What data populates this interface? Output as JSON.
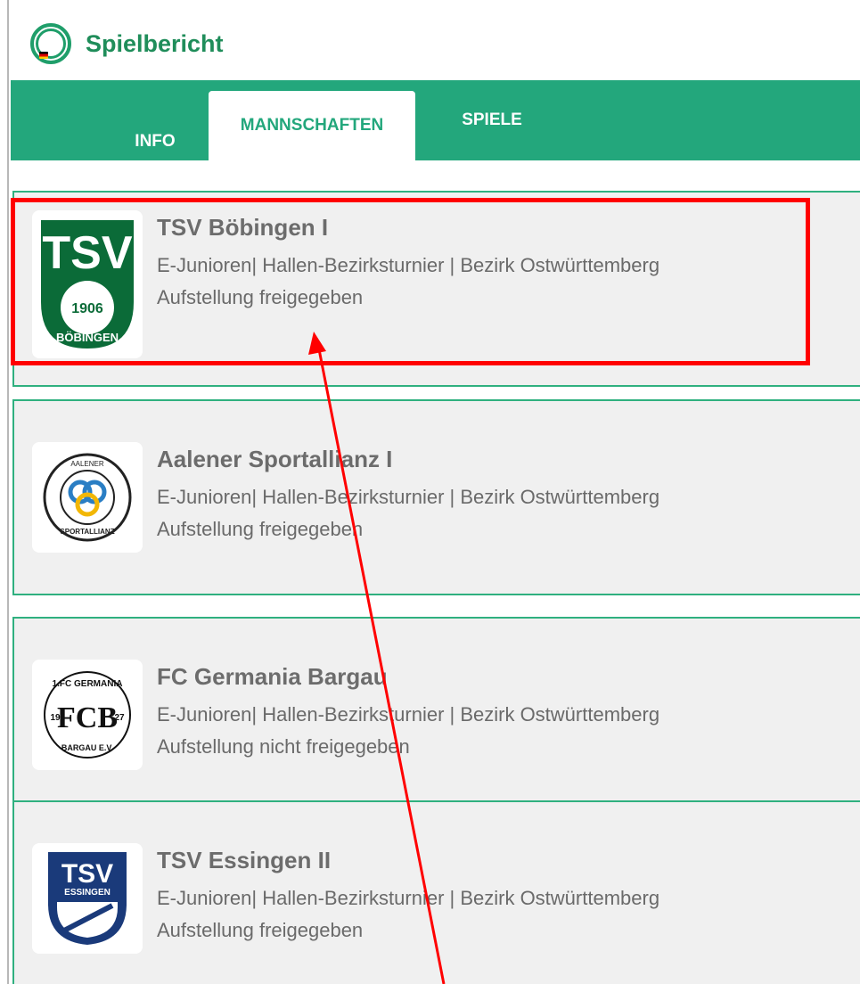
{
  "header": {
    "title": "Spielbericht",
    "logo_icon": "dfb-logo-icon"
  },
  "tabs": [
    {
      "label": "INFO",
      "active": false
    },
    {
      "label": "MANNSCHAFTEN",
      "active": true
    },
    {
      "label": "SPIELE",
      "active": false
    }
  ],
  "teams": [
    {
      "name": "TSV Böbingen I",
      "meta": "E-Junioren| Hallen-Bezirksturnier | Bezirk Ostwürttemberg",
      "status": "Aufstellung freigegeben",
      "crest": {
        "big": "TSV",
        "year": "1906",
        "arc": "BÖBINGEN"
      }
    },
    {
      "name": "Aalener Sportallianz I",
      "meta": "E-Junioren| Hallen-Bezirksturnier | Bezirk Ostwürttemberg",
      "status": "Aufstellung freigegeben",
      "crest": {
        "top": "AALENER",
        "bottom": "SPORTALLIANZ"
      }
    },
    {
      "name": "FC Germania Bargau",
      "meta": "E-Junioren| Hallen-Bezirksturnier | Bezirk Ostwürttemberg",
      "status": "Aufstellung nicht freigegeben",
      "crest": {
        "top": "1.FC GERMANIA",
        "center": "FCB",
        "left": "19",
        "right": "27",
        "bottom": "BARGAU E.V."
      }
    },
    {
      "name": "TSV Essingen II",
      "meta": "E-Junioren| Hallen-Bezirksturnier | Bezirk Ostwürttemberg",
      "status": "Aufstellung freigegeben",
      "crest": {
        "big": "TSV",
        "sub": "ESSINGEN"
      }
    }
  ],
  "colors": {
    "accent": "#23a77c",
    "title": "#1f8d5a",
    "highlight": "#ff0000",
    "card_bg": "#f0f0f0"
  }
}
